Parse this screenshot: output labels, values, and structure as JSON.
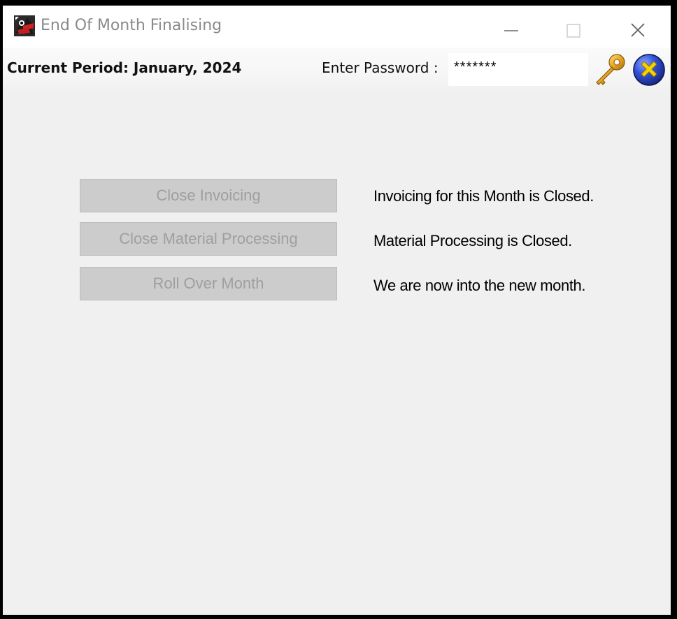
{
  "window": {
    "title": "End Of Month Finalising"
  },
  "toolbar": {
    "current_period": "Current Period: January, 2024",
    "password_label": "Enter Password :",
    "password_value": "*******"
  },
  "actions": [
    {
      "label": "Close Invoicing",
      "status": "Invoicing for this Month is Closed.",
      "enabled": false
    },
    {
      "label": "Close Material Processing",
      "status": "Material Processing is Closed.",
      "enabled": false
    },
    {
      "label": "Roll Over Month",
      "status": "We are now into the new month.",
      "enabled": false
    }
  ],
  "icons": {
    "app": "app-icon",
    "key": "key-icon",
    "exit": "exit-icon",
    "minimize": "minimize-icon",
    "maximize": "maximize-icon",
    "close": "close-icon"
  },
  "colors": {
    "window_bg": "#f0f0f0",
    "disabled_button_bg": "#cccccc",
    "disabled_text": "#9f9f9f",
    "title_text": "#8a8a8a",
    "exit_icon_blue": "#2b3fb8",
    "exit_icon_yellow": "#f5d200",
    "key_gold": "#e0a020"
  }
}
